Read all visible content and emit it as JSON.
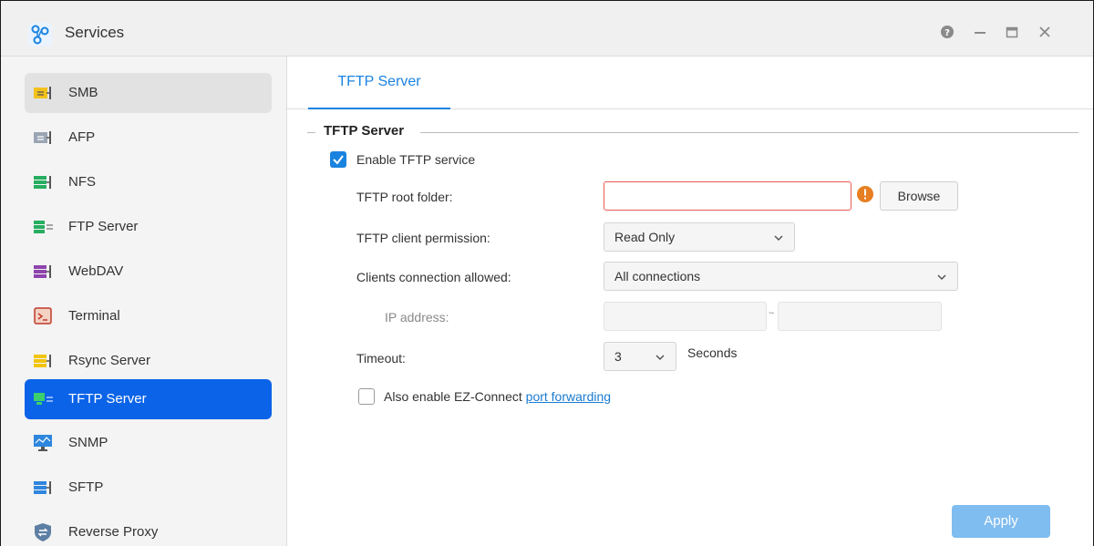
{
  "window": {
    "title": "Services",
    "accent_color": "#0b63e8"
  },
  "sidebar": {
    "items": [
      {
        "label": "SMB"
      },
      {
        "label": "AFP"
      },
      {
        "label": "NFS"
      },
      {
        "label": "FTP Server"
      },
      {
        "label": "WebDAV"
      },
      {
        "label": "Terminal"
      },
      {
        "label": "Rsync Server"
      },
      {
        "label": "TFTP Server",
        "active": true
      },
      {
        "label": "SNMP"
      },
      {
        "label": "SFTP"
      },
      {
        "label": "Reverse Proxy"
      }
    ]
  },
  "tabs": [
    {
      "label": "TFTP Server",
      "active": true
    }
  ],
  "form": {
    "section_title": "TFTP Server",
    "enable_label": "Enable TFTP service",
    "enable_checked": true,
    "root_folder_label": "TFTP root folder:",
    "root_folder_value": "",
    "browse_label": "Browse",
    "permission_label": "TFTP client permission:",
    "permission_value": "Read Only",
    "clients_label": "Clients connection allowed:",
    "clients_value": "All connections",
    "ip_label": "IP address:",
    "ip_separator": "~",
    "ip_from": "",
    "ip_to": "",
    "timeout_label": "Timeout:",
    "timeout_value": "3",
    "timeout_unit": "Seconds",
    "ez_label": "Also enable EZ-Connect",
    "ez_link": "port forwarding",
    "ez_checked": false,
    "apply_label": "Apply"
  }
}
